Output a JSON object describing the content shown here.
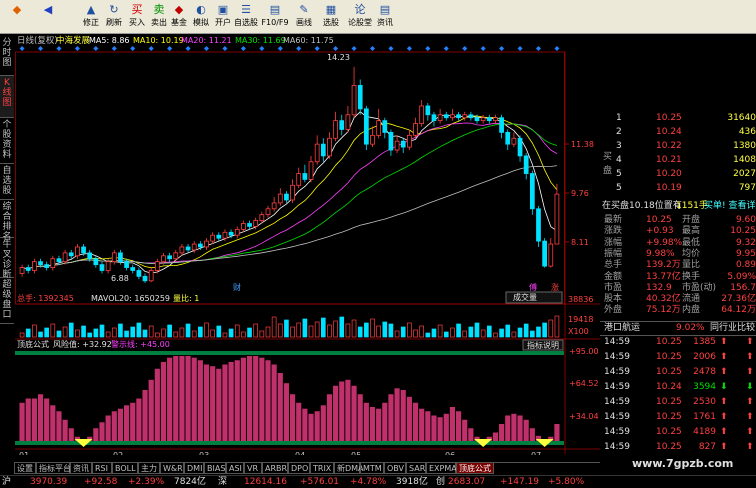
{
  "toolbar": {
    "buttons": [
      {
        "label": "",
        "icon": "logo-icon"
      },
      {
        "label": "",
        "icon": "back-icon"
      },
      {
        "label": "修正",
        "icon": "up-arrow-icon"
      },
      {
        "label": "刷新",
        "icon": "refresh-icon"
      },
      {
        "label": "买入",
        "icon": "buy-icon"
      },
      {
        "label": "卖出",
        "icon": "sell-icon"
      },
      {
        "label": "基金",
        "icon": "fund-icon"
      },
      {
        "label": "模拟",
        "icon": "simulate-icon"
      },
      {
        "label": "开户",
        "icon": "open-account-icon"
      },
      {
        "label": "自选股",
        "icon": "watchlist-icon"
      },
      {
        "label": "F10/F9",
        "icon": "f10-icon"
      },
      {
        "label": "画线",
        "icon": "draw-line-icon"
      },
      {
        "label": "选股",
        "icon": "stock-picker-icon"
      },
      {
        "label": "论股堂",
        "icon": "forum-icon"
      },
      {
        "label": "资讯",
        "icon": "news-icon"
      }
    ]
  },
  "left_tabs": [
    "分时图",
    "K线图",
    "个股资料",
    "自选股",
    "综合排名",
    "牛叉诊断",
    "超级盘口"
  ],
  "kline": {
    "header_left": "日线(复权)",
    "stock_name": "中海发展",
    "ma": [
      {
        "label": "MA5: 8.86",
        "color": "#ffffff"
      },
      {
        "label": "MA10: 10.19",
        "color": "#ffff00"
      },
      {
        "label": "MA20: 11.21",
        "color": "#ff40ff"
      },
      {
        "label": "MA30: 11.69",
        "color": "#00e000"
      },
      {
        "label": "MA60: 11.75",
        "color": "#c0c0c0"
      }
    ],
    "price_axis": [
      "11.38",
      "9.76",
      "8.11"
    ],
    "high_label": "14.23",
    "low_label": "6.88",
    "marker_cai": "财",
    "marker_zhang": "涨",
    "marker_fu": "傅",
    "candles": [
      [
        7.2,
        7.4,
        7.5,
        7.1,
        1
      ],
      [
        7.4,
        7.3,
        7.5,
        7.2,
        0
      ],
      [
        7.3,
        7.6,
        7.7,
        7.2,
        1
      ],
      [
        7.6,
        7.5,
        7.7,
        7.4,
        0
      ],
      [
        7.5,
        7.4,
        7.6,
        7.3,
        0
      ],
      [
        7.4,
        7.7,
        7.8,
        7.3,
        1
      ],
      [
        7.7,
        7.6,
        7.8,
        7.5,
        0
      ],
      [
        7.6,
        7.9,
        8.0,
        7.5,
        1
      ],
      [
        7.9,
        7.8,
        8.0,
        7.7,
        0
      ],
      [
        7.8,
        8.1,
        8.2,
        7.7,
        1
      ],
      [
        8.1,
        7.9,
        8.2,
        7.8,
        0
      ],
      [
        7.9,
        7.7,
        8.0,
        7.6,
        0
      ],
      [
        7.7,
        7.5,
        7.8,
        7.4,
        0
      ],
      [
        7.5,
        7.3,
        7.6,
        7.2,
        0
      ],
      [
        7.3,
        7.6,
        7.7,
        7.2,
        1
      ],
      [
        7.6,
        7.9,
        8.0,
        7.5,
        1
      ],
      [
        7.9,
        7.6,
        8.0,
        7.5,
        0
      ],
      [
        7.6,
        7.4,
        7.7,
        7.3,
        0
      ],
      [
        7.4,
        7.3,
        7.5,
        7.2,
        0
      ],
      [
        7.3,
        7.1,
        7.4,
        7.0,
        0
      ],
      [
        7.1,
        6.95,
        7.2,
        6.88,
        0
      ],
      [
        6.95,
        7.3,
        7.4,
        6.9,
        1
      ],
      [
        7.3,
        7.6,
        7.7,
        7.2,
        1
      ],
      [
        7.6,
        7.8,
        7.9,
        7.5,
        1
      ],
      [
        7.8,
        7.7,
        7.9,
        7.6,
        0
      ],
      [
        7.7,
        7.9,
        8.0,
        7.6,
        1
      ],
      [
        7.9,
        8.1,
        8.2,
        7.8,
        1
      ],
      [
        8.1,
        8.0,
        8.2,
        7.9,
        0
      ],
      [
        8.0,
        8.2,
        8.3,
        7.9,
        1
      ],
      [
        8.2,
        8.1,
        8.3,
        8.0,
        0
      ],
      [
        8.1,
        8.3,
        8.4,
        8.0,
        1
      ],
      [
        8.3,
        8.5,
        8.6,
        8.2,
        1
      ],
      [
        8.5,
        8.4,
        8.6,
        8.3,
        0
      ],
      [
        8.4,
        8.6,
        8.7,
        8.3,
        1
      ],
      [
        8.6,
        8.5,
        8.7,
        8.4,
        0
      ],
      [
        8.5,
        8.7,
        8.8,
        8.4,
        1
      ],
      [
        8.7,
        8.9,
        9.0,
        8.6,
        1
      ],
      [
        8.9,
        8.8,
        9.0,
        8.7,
        0
      ],
      [
        8.8,
        9.0,
        9.1,
        8.7,
        1
      ],
      [
        9.0,
        9.2,
        9.3,
        8.9,
        1
      ],
      [
        9.2,
        9.4,
        9.5,
        9.1,
        1
      ],
      [
        9.4,
        9.6,
        9.8,
        9.3,
        1
      ],
      [
        9.6,
        9.9,
        10.1,
        9.5,
        1
      ],
      [
        9.9,
        9.7,
        10.0,
        9.6,
        0
      ],
      [
        9.7,
        10.2,
        10.4,
        9.6,
        1
      ],
      [
        10.2,
        10.6,
        10.8,
        10.1,
        1
      ],
      [
        10.6,
        10.4,
        10.9,
        10.3,
        0
      ],
      [
        10.4,
        11.0,
        11.2,
        10.3,
        1
      ],
      [
        11.0,
        11.6,
        11.9,
        10.9,
        1
      ],
      [
        11.6,
        11.2,
        11.8,
        11.0,
        0
      ],
      [
        11.2,
        11.8,
        12.0,
        11.1,
        1
      ],
      [
        11.8,
        12.4,
        12.7,
        11.7,
        1
      ],
      [
        12.4,
        12.1,
        12.6,
        11.9,
        0
      ],
      [
        12.1,
        12.6,
        12.9,
        12.0,
        1
      ],
      [
        12.6,
        13.6,
        14.23,
        12.5,
        1
      ],
      [
        13.6,
        12.8,
        13.8,
        12.6,
        0
      ],
      [
        12.8,
        11.6,
        12.9,
        11.4,
        0
      ],
      [
        11.6,
        11.9,
        12.2,
        11.5,
        1
      ],
      [
        11.9,
        12.4,
        12.8,
        11.8,
        1
      ],
      [
        12.4,
        12.0,
        12.5,
        11.8,
        0
      ],
      [
        12.0,
        11.4,
        12.1,
        11.2,
        0
      ],
      [
        11.4,
        11.7,
        11.9,
        11.3,
        1
      ],
      [
        11.7,
        11.5,
        11.8,
        11.3,
        0
      ],
      [
        11.5,
        11.9,
        12.1,
        11.4,
        1
      ],
      [
        11.9,
        12.3,
        12.5,
        11.8,
        1
      ],
      [
        12.3,
        12.9,
        13.1,
        12.2,
        1
      ],
      [
        12.9,
        12.6,
        13.0,
        12.4,
        0
      ],
      [
        12.6,
        12.4,
        12.7,
        12.2,
        0
      ],
      [
        12.4,
        12.6,
        12.8,
        12.3,
        1
      ],
      [
        12.6,
        12.5,
        12.7,
        12.4,
        0
      ],
      [
        12.5,
        12.6,
        12.8,
        12.4,
        1
      ],
      [
        12.6,
        12.5,
        12.7,
        12.4,
        0
      ],
      [
        12.5,
        12.6,
        12.7,
        12.4,
        1
      ],
      [
        12.6,
        12.5,
        12.7,
        12.4,
        0
      ],
      [
        12.5,
        12.4,
        12.6,
        12.3,
        0
      ],
      [
        12.4,
        12.5,
        12.6,
        12.3,
        1
      ],
      [
        12.5,
        12.4,
        12.6,
        12.3,
        0
      ],
      [
        12.4,
        12.5,
        12.6,
        12.3,
        1
      ],
      [
        12.5,
        12.0,
        12.6,
        11.8,
        0
      ],
      [
        12.0,
        11.6,
        12.1,
        11.4,
        0
      ],
      [
        11.6,
        11.8,
        12.0,
        11.5,
        1
      ],
      [
        11.8,
        11.2,
        11.9,
        11.0,
        0
      ],
      [
        11.2,
        10.6,
        11.3,
        10.4,
        0
      ],
      [
        10.6,
        9.4,
        10.7,
        9.2,
        0
      ],
      [
        9.4,
        8.3,
        9.5,
        8.1,
        0
      ],
      [
        8.3,
        7.45,
        8.4,
        7.4,
        0
      ],
      [
        7.45,
        8.2,
        8.4,
        7.4,
        1
      ],
      [
        8.2,
        9.9,
        10.25,
        8.2,
        1
      ]
    ]
  },
  "volume": {
    "label": "总手: 1392345",
    "mavol": "MAVOL20: 1650259",
    "liangbi": "量比: 1",
    "button": "成交量",
    "axis_top": "38836",
    "axis_mid": "19418",
    "axis_unit": "X100"
  },
  "indicator": {
    "name": "顶底公式",
    "risk": "风险值: +32.92",
    "warn": "警示线: +45.00",
    "button": "指标说明",
    "axis": [
      "+95.00",
      "+64.52",
      "+34.04"
    ]
  },
  "x_axis": {
    "labels": [
      "01",
      "02",
      "03",
      "04",
      "05",
      "06",
      "07"
    ]
  },
  "order_book": {
    "sell": [
      {
        "lvl": "1",
        "price": "10.25",
        "vol": "31640"
      },
      {
        "lvl": "2",
        "price": "10.24",
        "vol": "436"
      },
      {
        "lvl": "3",
        "price": "10.22",
        "vol": "1380"
      },
      {
        "lvl": "4",
        "price": "10.21",
        "vol": "1408"
      },
      {
        "lvl": "5",
        "price": "10.20",
        "vol": "2027"
      },
      {
        "lvl": "5",
        "price": "10.19",
        "vol": "797"
      }
    ],
    "buy_label": "买盘",
    "note_left": "在买盘10.18位置有",
    "note_mid": "1151手",
    "note_right": "买单!  查看详细",
    "stats": [
      {
        "k1": "最新",
        "v1": "10.25",
        "k2": "开盘",
        "v2": "9.60"
      },
      {
        "k1": "涨跌",
        "v1": "+0.93",
        "k2": "最高",
        "v2": "10.25"
      },
      {
        "k1": "涨幅",
        "v1": "+9.98%",
        "k2": "最低",
        "v2": "9.32"
      },
      {
        "k1": "振幅",
        "v1": "9.98%",
        "k2": "均价",
        "v2": "9.95"
      },
      {
        "k1": "总手",
        "v1": "139.2万",
        "k2": "量比",
        "v2": "0.89"
      },
      {
        "k1": "金额",
        "v1": "13.77亿",
        "k2": "换手",
        "v2": "5.09%"
      },
      {
        "k1": "市盈",
        "v1": "132.9",
        "k2": "市盈(动)",
        "v2": "156.7"
      },
      {
        "k1": "股本",
        "v1": "40.32亿",
        "k2": "流通",
        "v2": "27.36亿"
      },
      {
        "k1": "外盘",
        "v1": "75.12万",
        "k2": "内盘",
        "v2": "64.12万"
      }
    ],
    "sector_left": "港口航运",
    "sector_pct": "9.02%",
    "sector_right": "同行业比较",
    "ticks": [
      {
        "t": "14:59",
        "p": "10.25",
        "v": "1385",
        "up": true
      },
      {
        "t": "14:59",
        "p": "10.25",
        "v": "2006",
        "up": true
      },
      {
        "t": "14:59",
        "p": "10.25",
        "v": "2478",
        "up": true
      },
      {
        "t": "14:59",
        "p": "10.24",
        "v": "3594",
        "up": false
      },
      {
        "t": "14:59",
        "p": "10.25",
        "v": "2530",
        "up": true
      },
      {
        "t": "14:59",
        "p": "10.25",
        "v": "1761",
        "up": true
      },
      {
        "t": "14:59",
        "p": "10.25",
        "v": "4189",
        "up": true
      },
      {
        "t": "14:59",
        "p": "10.25",
        "v": "827",
        "up": true
      }
    ]
  },
  "bottom_tabs": [
    "设置",
    "指标平台",
    "资讯",
    "RSI",
    "BOLL",
    "主力",
    "W&R",
    "DMI",
    "BIAS",
    "ASI",
    "VR",
    "ARBR",
    "DPO",
    "TRIX",
    "新DMA",
    "MTM",
    "OBV",
    "SAR",
    "EXPMA",
    "顶底公式"
  ],
  "watermark": "www.7gpzb.com",
  "status": [
    {
      "text": "沪",
      "cls": "white"
    },
    {
      "text": "3970.39",
      "cls": "red"
    },
    {
      "text": "+92.58",
      "cls": "red"
    },
    {
      "text": "+2.39%",
      "cls": "red"
    },
    {
      "text": "7824亿",
      "cls": "white"
    },
    {
      "text": "深",
      "cls": "white"
    },
    {
      "text": "12614.16",
      "cls": "red"
    },
    {
      "text": "+576.01",
      "cls": "red"
    },
    {
      "text": "+4.78%",
      "cls": "red"
    },
    {
      "text": "3918亿",
      "cls": "white"
    },
    {
      "text": "创",
      "cls": "white"
    },
    {
      "text": "2683.07",
      "cls": "red"
    },
    {
      "text": "+147.19",
      "cls": "red"
    },
    {
      "text": "+5.80%",
      "cls": "red"
    }
  ],
  "colors": {
    "up": "#ff4040",
    "down": "#00e0ff",
    "ma5": "#ffffff",
    "ma10": "#ffff00",
    "ma20": "#ff40ff",
    "ma30": "#00e000",
    "ma60": "#c0c0c0"
  }
}
